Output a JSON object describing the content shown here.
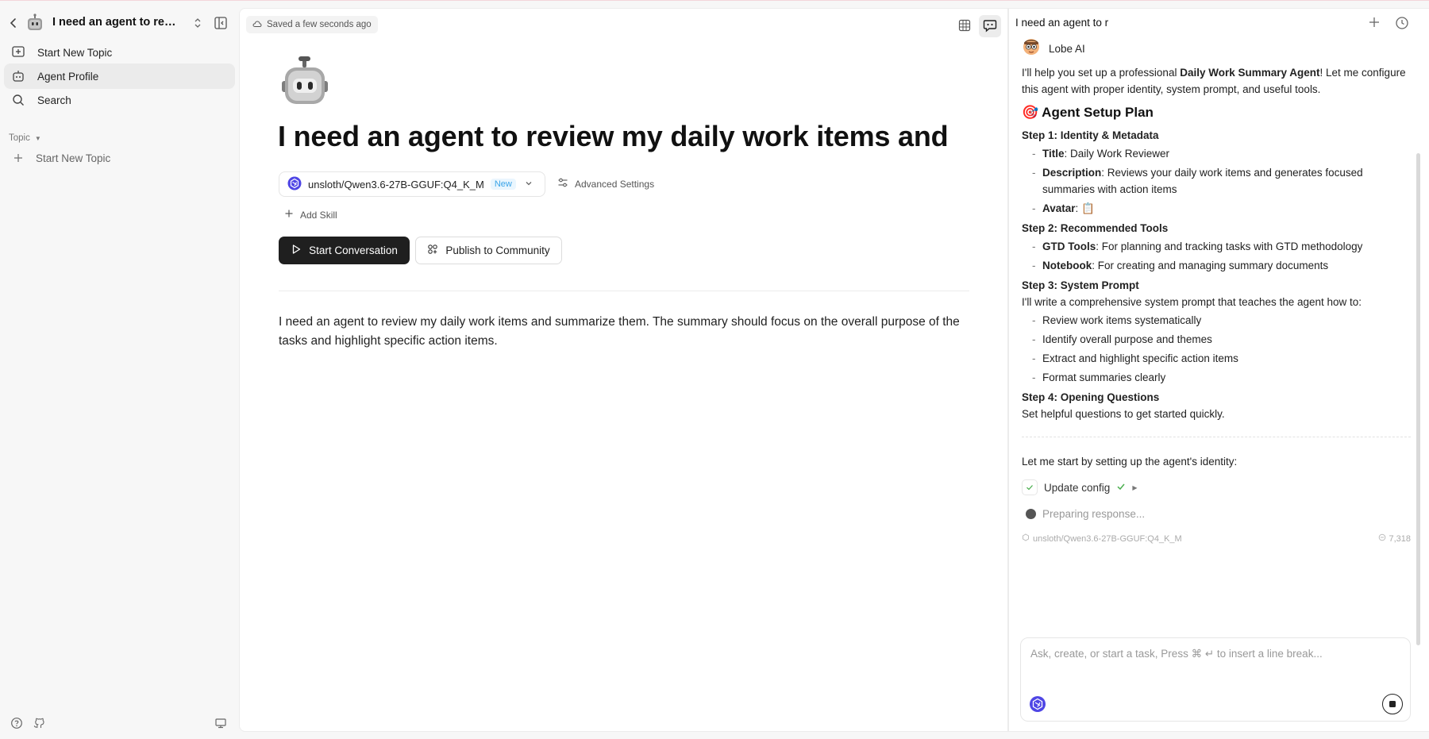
{
  "sidebar": {
    "title": "I need an agent to revie...",
    "items": [
      {
        "label": "Start New Topic",
        "icon": "new-topic-icon"
      },
      {
        "label": "Agent Profile",
        "icon": "robot-icon"
      },
      {
        "label": "Search",
        "icon": "search-icon"
      }
    ],
    "section_label": "Topic",
    "topic_new": "Start New Topic"
  },
  "main": {
    "saved_label": "Saved a few seconds ago",
    "agent_title": "I need an agent to review my daily work items and",
    "model": {
      "name": "unsloth/Qwen3.6-27B-GGUF:Q4_K_M",
      "badge": "New"
    },
    "advanced_settings": "Advanced Settings",
    "add_skill": "Add Skill",
    "start_button": "Start Conversation",
    "publish_button": "Publish to Community",
    "description": "I need an agent to review my daily work items and summarize them. The summary should focus on the overall purpose of the tasks and highlight specific action items."
  },
  "chat": {
    "title": "I need an agent to r",
    "sender": "Lobe AI",
    "intro_pre": "I'll help you set up a professional ",
    "intro_bold": "Daily Work Summary Agent",
    "intro_post": "! Let me configure this agent with proper identity, system prompt, and useful tools.",
    "plan_title": "Agent Setup Plan",
    "steps": [
      {
        "title": "Step 1: Identity & Metadata",
        "items": [
          {
            "bold": "Title",
            "text": ": Daily Work Reviewer"
          },
          {
            "bold": "Description",
            "text": ": Reviews your daily work items and generates focused summaries with action items"
          },
          {
            "bold": "Avatar",
            "text": ": 📋"
          }
        ]
      },
      {
        "title": "Step 2: Recommended Tools",
        "items": [
          {
            "bold": "GTD Tools",
            "text": ": For planning and tracking tasks with GTD methodology"
          },
          {
            "bold": "Notebook",
            "text": ": For creating and managing summary documents"
          }
        ]
      }
    ],
    "step3_title": "Step 3: System Prompt",
    "step3_text": "I'll write a comprehensive system prompt that teaches the agent how to:",
    "step3_items": [
      "Review work items systematically",
      "Identify overall purpose and themes",
      "Extract and highlight specific action items",
      "Format summaries clearly"
    ],
    "step4_title": "Step 4: Opening Questions",
    "step4_text": "Set helpful questions to get started quickly.",
    "lead": "Let me start by setting up the agent's identity:",
    "tool_call": "Update config",
    "preparing": "Preparing response...",
    "model_meta": "unsloth/Qwen3.6-27B-GGUF:Q4_K_M",
    "token_count": "7,318",
    "composer_placeholder": "Ask, create, or start a task, Press ⌘ ↵ to insert a line break..."
  }
}
